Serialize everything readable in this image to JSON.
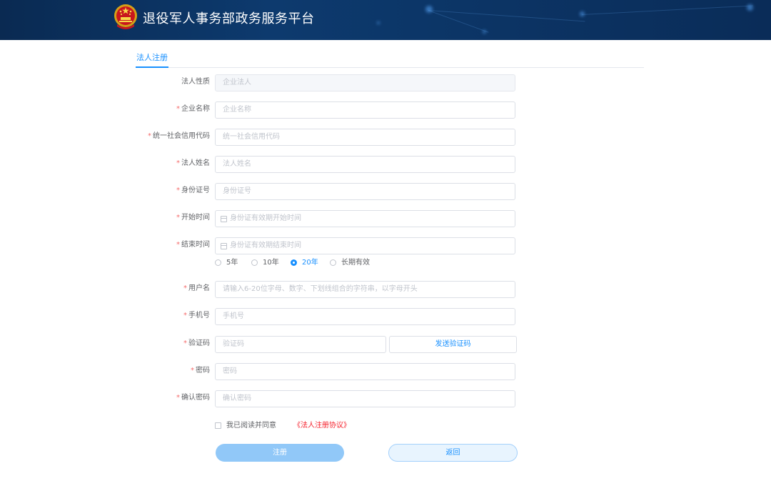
{
  "header": {
    "title": "退役军人事务部政务服务平台",
    "emblem": "national-emblem-icon"
  },
  "tabs": [
    {
      "label": "法人注册",
      "active": true
    }
  ],
  "form": {
    "nature": {
      "label": "法人性质",
      "placeholder": "企业法人",
      "required": false,
      "disabled": true
    },
    "company": {
      "label": "企业名称",
      "placeholder": "企业名称",
      "required": true
    },
    "credit": {
      "label": "统一社会信用代码",
      "placeholder": "统一社会信用代码",
      "required": true
    },
    "legal_name": {
      "label": "法人姓名",
      "placeholder": "法人姓名",
      "required": true
    },
    "id_number": {
      "label": "身份证号",
      "placeholder": "身份证号",
      "required": true
    },
    "start_date": {
      "label": "开始时间",
      "placeholder": "身份证有效期开始时间",
      "required": true,
      "icon": "calendar-icon"
    },
    "end_date": {
      "label": "结束时间",
      "placeholder": "身份证有效期结束时间",
      "required": true,
      "icon": "calendar-icon"
    },
    "validity": {
      "options": [
        "5年",
        "10年",
        "20年",
        "长期有效"
      ],
      "selected": "20年"
    },
    "username": {
      "label": "用户名",
      "placeholder": "请输入6-20位字母、数字、下划线组合的字符串，以字母开头",
      "required": true
    },
    "phone": {
      "label": "手机号",
      "placeholder": "手机号",
      "required": true
    },
    "code": {
      "label": "验证码",
      "placeholder": "验证码",
      "required": true,
      "send_label": "发送验证码"
    },
    "password": {
      "label": "密码",
      "placeholder": "密码",
      "required": true
    },
    "confirm": {
      "label": "确认密码",
      "placeholder": "确认密码",
      "required": true
    },
    "required_mark": "*"
  },
  "agreement": {
    "text": "我已阅读并同意",
    "link": "《法人注册协议》",
    "checked": false
  },
  "buttons": {
    "register": "注册",
    "back": "返回"
  },
  "colors": {
    "accent": "#1890ff",
    "required": "#f56c6c",
    "link": "#f5222d",
    "header": "#0d3a6e"
  }
}
